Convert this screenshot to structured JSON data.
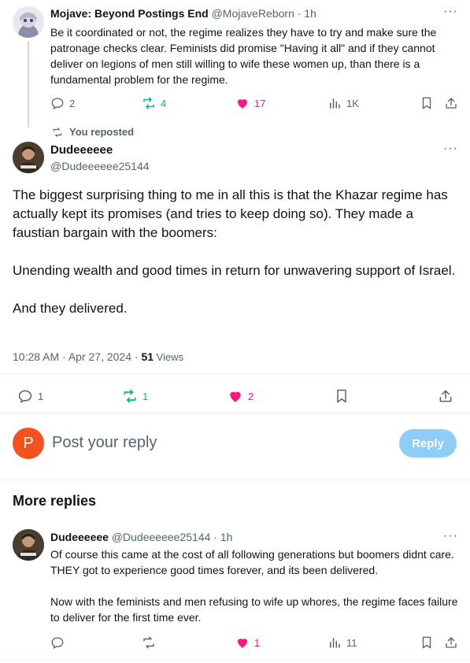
{
  "parent_tweet": {
    "display_name": "Mojave: Beyond Postings End",
    "handle": "@MojaveReborn",
    "time": "· 1h",
    "text": "Be it coordinated or not, the regime realizes they have to try and make sure the patronage checks clear. Feminists did promise \"Having it all\" and if they cannot deliver on legions of men still willing to wife these women up, than there is a fundamental problem for the regime.",
    "replies": "2",
    "reposts": "4",
    "likes": "17",
    "views": "1K"
  },
  "main_tweet": {
    "repost_label": "You reposted",
    "display_name": "Dudeeeeee",
    "handle": "@Dudeeeeee25144",
    "para1": "The biggest surprising thing to me in all this is that the Khazar regime has actually kept its promises (and tries to keep doing so).  They made a faustian bargain with the boomers:",
    "para2": "Unending wealth and good times in return for unwavering support of Israel.",
    "para3": "And they delivered.",
    "timestamp": "10:28 AM · Apr 27, 2024 · ",
    "views_count": "51",
    "views_label": " Views",
    "replies": "1",
    "reposts": "1",
    "likes": "2"
  },
  "reply_box": {
    "avatar_letter": "P",
    "placeholder": "Post your reply",
    "button_label": "Reply"
  },
  "more_replies": {
    "heading": "More replies",
    "reply": {
      "display_name": "Dudeeeeee",
      "handle": "@Dudeeeeee25144",
      "time": "· 1h",
      "para1": "Of course this came at the cost of all following generations but boomers didnt care. THEY got to experience good times forever, and its been delivered.",
      "para2": "Now with the feminists and men refusing to wife up whores, the regime faces failure to deliver for the first time ever.",
      "likes": "1",
      "views": "11"
    }
  },
  "colors": {
    "accent": "#1d9bf0",
    "like": "#f91880",
    "repost": "#00ba7c",
    "muted": "#536471",
    "reply_avatar": "#f4511e"
  },
  "icons": [
    "reply-icon",
    "repost-icon",
    "heart-icon",
    "views-icon",
    "bookmark-icon",
    "share-icon",
    "more-icon"
  ]
}
